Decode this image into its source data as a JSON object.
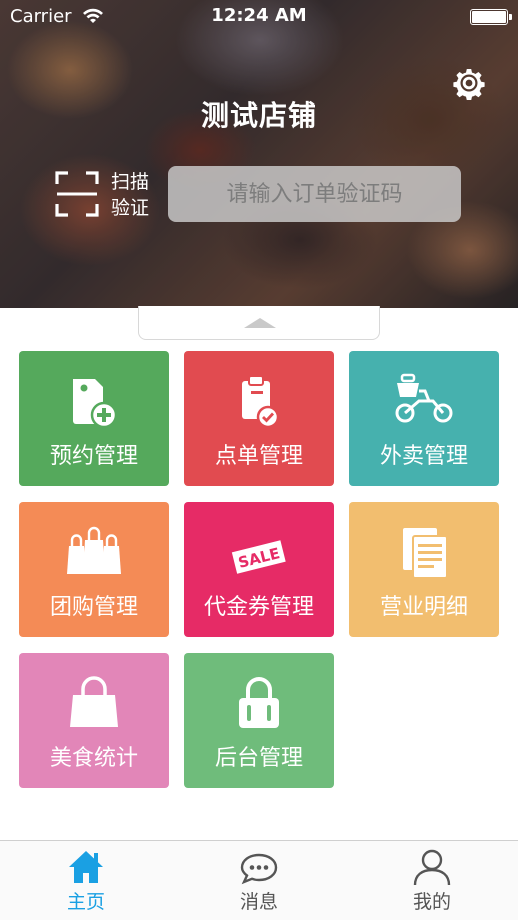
{
  "status_bar": {
    "carrier": "Carrier",
    "time": "12:24 AM"
  },
  "header": {
    "store_name": "测试店铺",
    "scan_label_line1": "扫描",
    "scan_label_line2": "验证",
    "code_input_placeholder": "请输入订单验证码",
    "code_input_value": ""
  },
  "grid": {
    "tiles": [
      {
        "label": "预约管理",
        "color": "#55a95c",
        "icon": "tag-plus-icon"
      },
      {
        "label": "点单管理",
        "color": "#e14b50",
        "icon": "clipboard-check-icon"
      },
      {
        "label": "外卖管理",
        "color": "#46b1ae",
        "icon": "delivery-bike-icon"
      },
      {
        "label": "团购管理",
        "color": "#f48b56",
        "icon": "shopping-bags-icon"
      },
      {
        "label": "代金券管理",
        "color": "#e62b66",
        "icon": "sale-ticket-icon"
      },
      {
        "label": "营业明细",
        "color": "#f2be6f",
        "icon": "documents-icon"
      },
      {
        "label": "美食统计",
        "color": "#e286b8",
        "icon": "bag-icon"
      },
      {
        "label": "后台管理",
        "color": "#6fbc7b",
        "icon": "lock-icon"
      }
    ],
    "badge_text": "SALE"
  },
  "tab_bar": {
    "active_color": "#1aa0e3",
    "tabs": [
      {
        "label": "主页",
        "icon": "home-icon",
        "active": true
      },
      {
        "label": "消息",
        "icon": "message-icon",
        "active": false
      },
      {
        "label": "我的",
        "icon": "user-icon",
        "active": false
      }
    ]
  }
}
